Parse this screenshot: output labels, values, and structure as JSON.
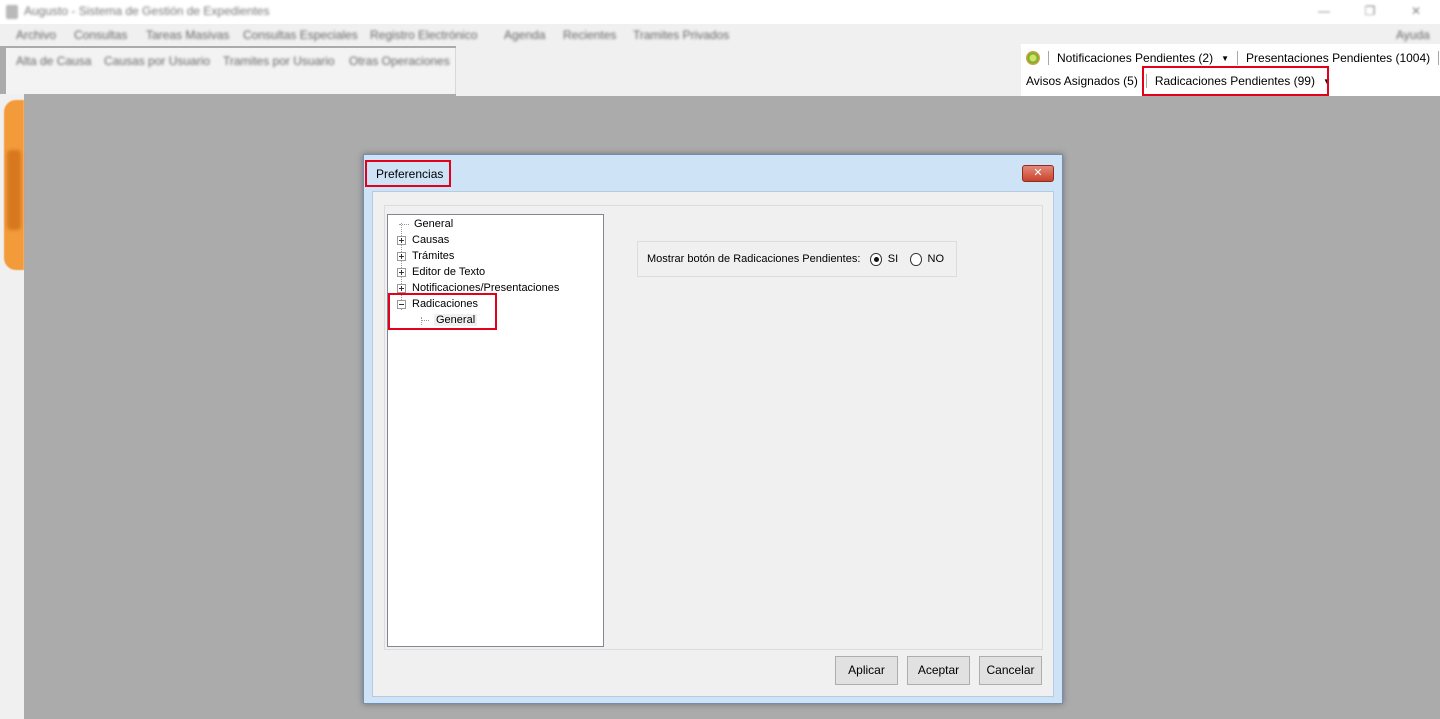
{
  "window": {
    "title": "Augusto - Sistema de Gestión de Expedientes",
    "controls": [
      "—",
      "❐",
      "✕"
    ]
  },
  "menubar": [
    "Archivo",
    "Consultas",
    "Tareas Masivas",
    "Consultas Especiales",
    "Registro Electrónico",
    "Agenda",
    "Recientes",
    "Tramites Privados"
  ],
  "menubar_right": "Ayuda",
  "toolstrip": [
    "Alta de Causa",
    "Causas por Usuario",
    "Tramites por Usuario",
    "Otras Operaciones"
  ],
  "notifications": {
    "notificaciones": "Notificaciones Pendientes (2)",
    "presentaciones": "Presentaciones Pendientes (1004)",
    "avisos": "Avisos Asignados (5)",
    "radicaciones": "Radicaciones Pendientes (99)",
    "dropdown_glyph": "▼",
    "status_icon": "status-ok-icon"
  },
  "dialog": {
    "title": "Preferencias",
    "close_glyph": "✕",
    "tree": {
      "general": "General",
      "causas": "Causas",
      "tramites": "Trámites",
      "editor": "Editor de Texto",
      "notificaciones": "Notificaciones/Presentaciones",
      "radicaciones": "Radicaciones",
      "radicaciones_general": "General"
    },
    "option": {
      "label": "Mostrar botón de Radicaciones Pendientes:",
      "yes": "SI",
      "no": "NO",
      "selected": "SI"
    },
    "buttons": {
      "apply": "Aplicar",
      "accept": "Aceptar",
      "cancel": "Cancelar"
    }
  },
  "colors": {
    "highlight": "#e3001b",
    "dialog_frame": "#cfe3f6",
    "side_tab": "#f39a3b"
  }
}
